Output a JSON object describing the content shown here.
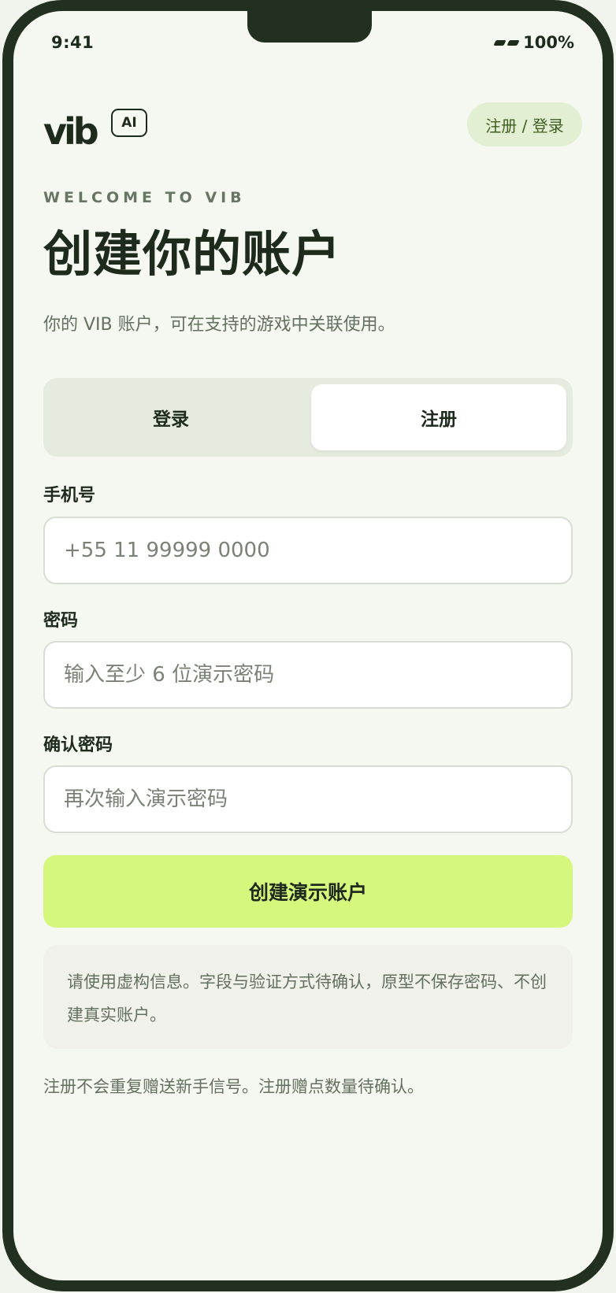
{
  "status_bar": {
    "time": "9:41",
    "battery": "100%"
  },
  "header": {
    "logo": "vib",
    "ai_badge": "AI",
    "auth_link": "注册 / 登录"
  },
  "hero": {
    "eyebrow": "WELCOME TO VIB",
    "title": "创建你的账户",
    "subtitle": "你的 VIB 账户，可在支持的游戏中关联使用。"
  },
  "tabs": {
    "login": "登录",
    "register": "注册",
    "active": "register"
  },
  "form": {
    "phone": {
      "label": "手机号",
      "placeholder": "+55 11 99999 0000",
      "value": ""
    },
    "password": {
      "label": "密码",
      "placeholder": "输入至少 6 位演示密码",
      "value": ""
    },
    "confirm": {
      "label": "确认密码",
      "placeholder": "再次输入演示密码",
      "value": ""
    },
    "submit": "创建演示账户"
  },
  "notice": "请使用虚构信息。字段与验证方式待确认，原型不保存密码、不创建真实账户。",
  "footnote": "注册不会重复赠送新手信号。注册赠点数量待确认。",
  "colors": {
    "frame": "#22301f",
    "background": "#f5f8f0",
    "accent": "#d6f77e",
    "pill_bg": "#e3efd2",
    "pill_text": "#3f5e21"
  }
}
